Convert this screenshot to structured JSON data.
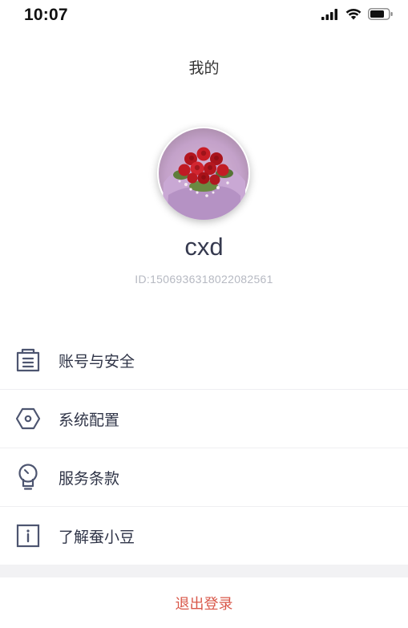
{
  "status_bar": {
    "time": "10:07",
    "icons": [
      "signal-icon",
      "wifi-icon",
      "battery-icon"
    ]
  },
  "header": {
    "title": "我的"
  },
  "profile": {
    "username": "cxd",
    "user_id": "ID:1506936318022082561"
  },
  "menu": {
    "items": [
      {
        "label": "账号与安全",
        "icon": "account-security-icon"
      },
      {
        "label": "系统配置",
        "icon": "settings-hexagon-icon"
      },
      {
        "label": "服务条款",
        "icon": "terms-bulb-icon"
      },
      {
        "label": "了解蚕小豆",
        "icon": "info-icon"
      }
    ]
  },
  "logout": {
    "label": "退出登录"
  },
  "colors": {
    "text": "#2f3447",
    "icon": "#4d5570",
    "logout": "#d9584a",
    "muted": "#b6b9c2"
  }
}
